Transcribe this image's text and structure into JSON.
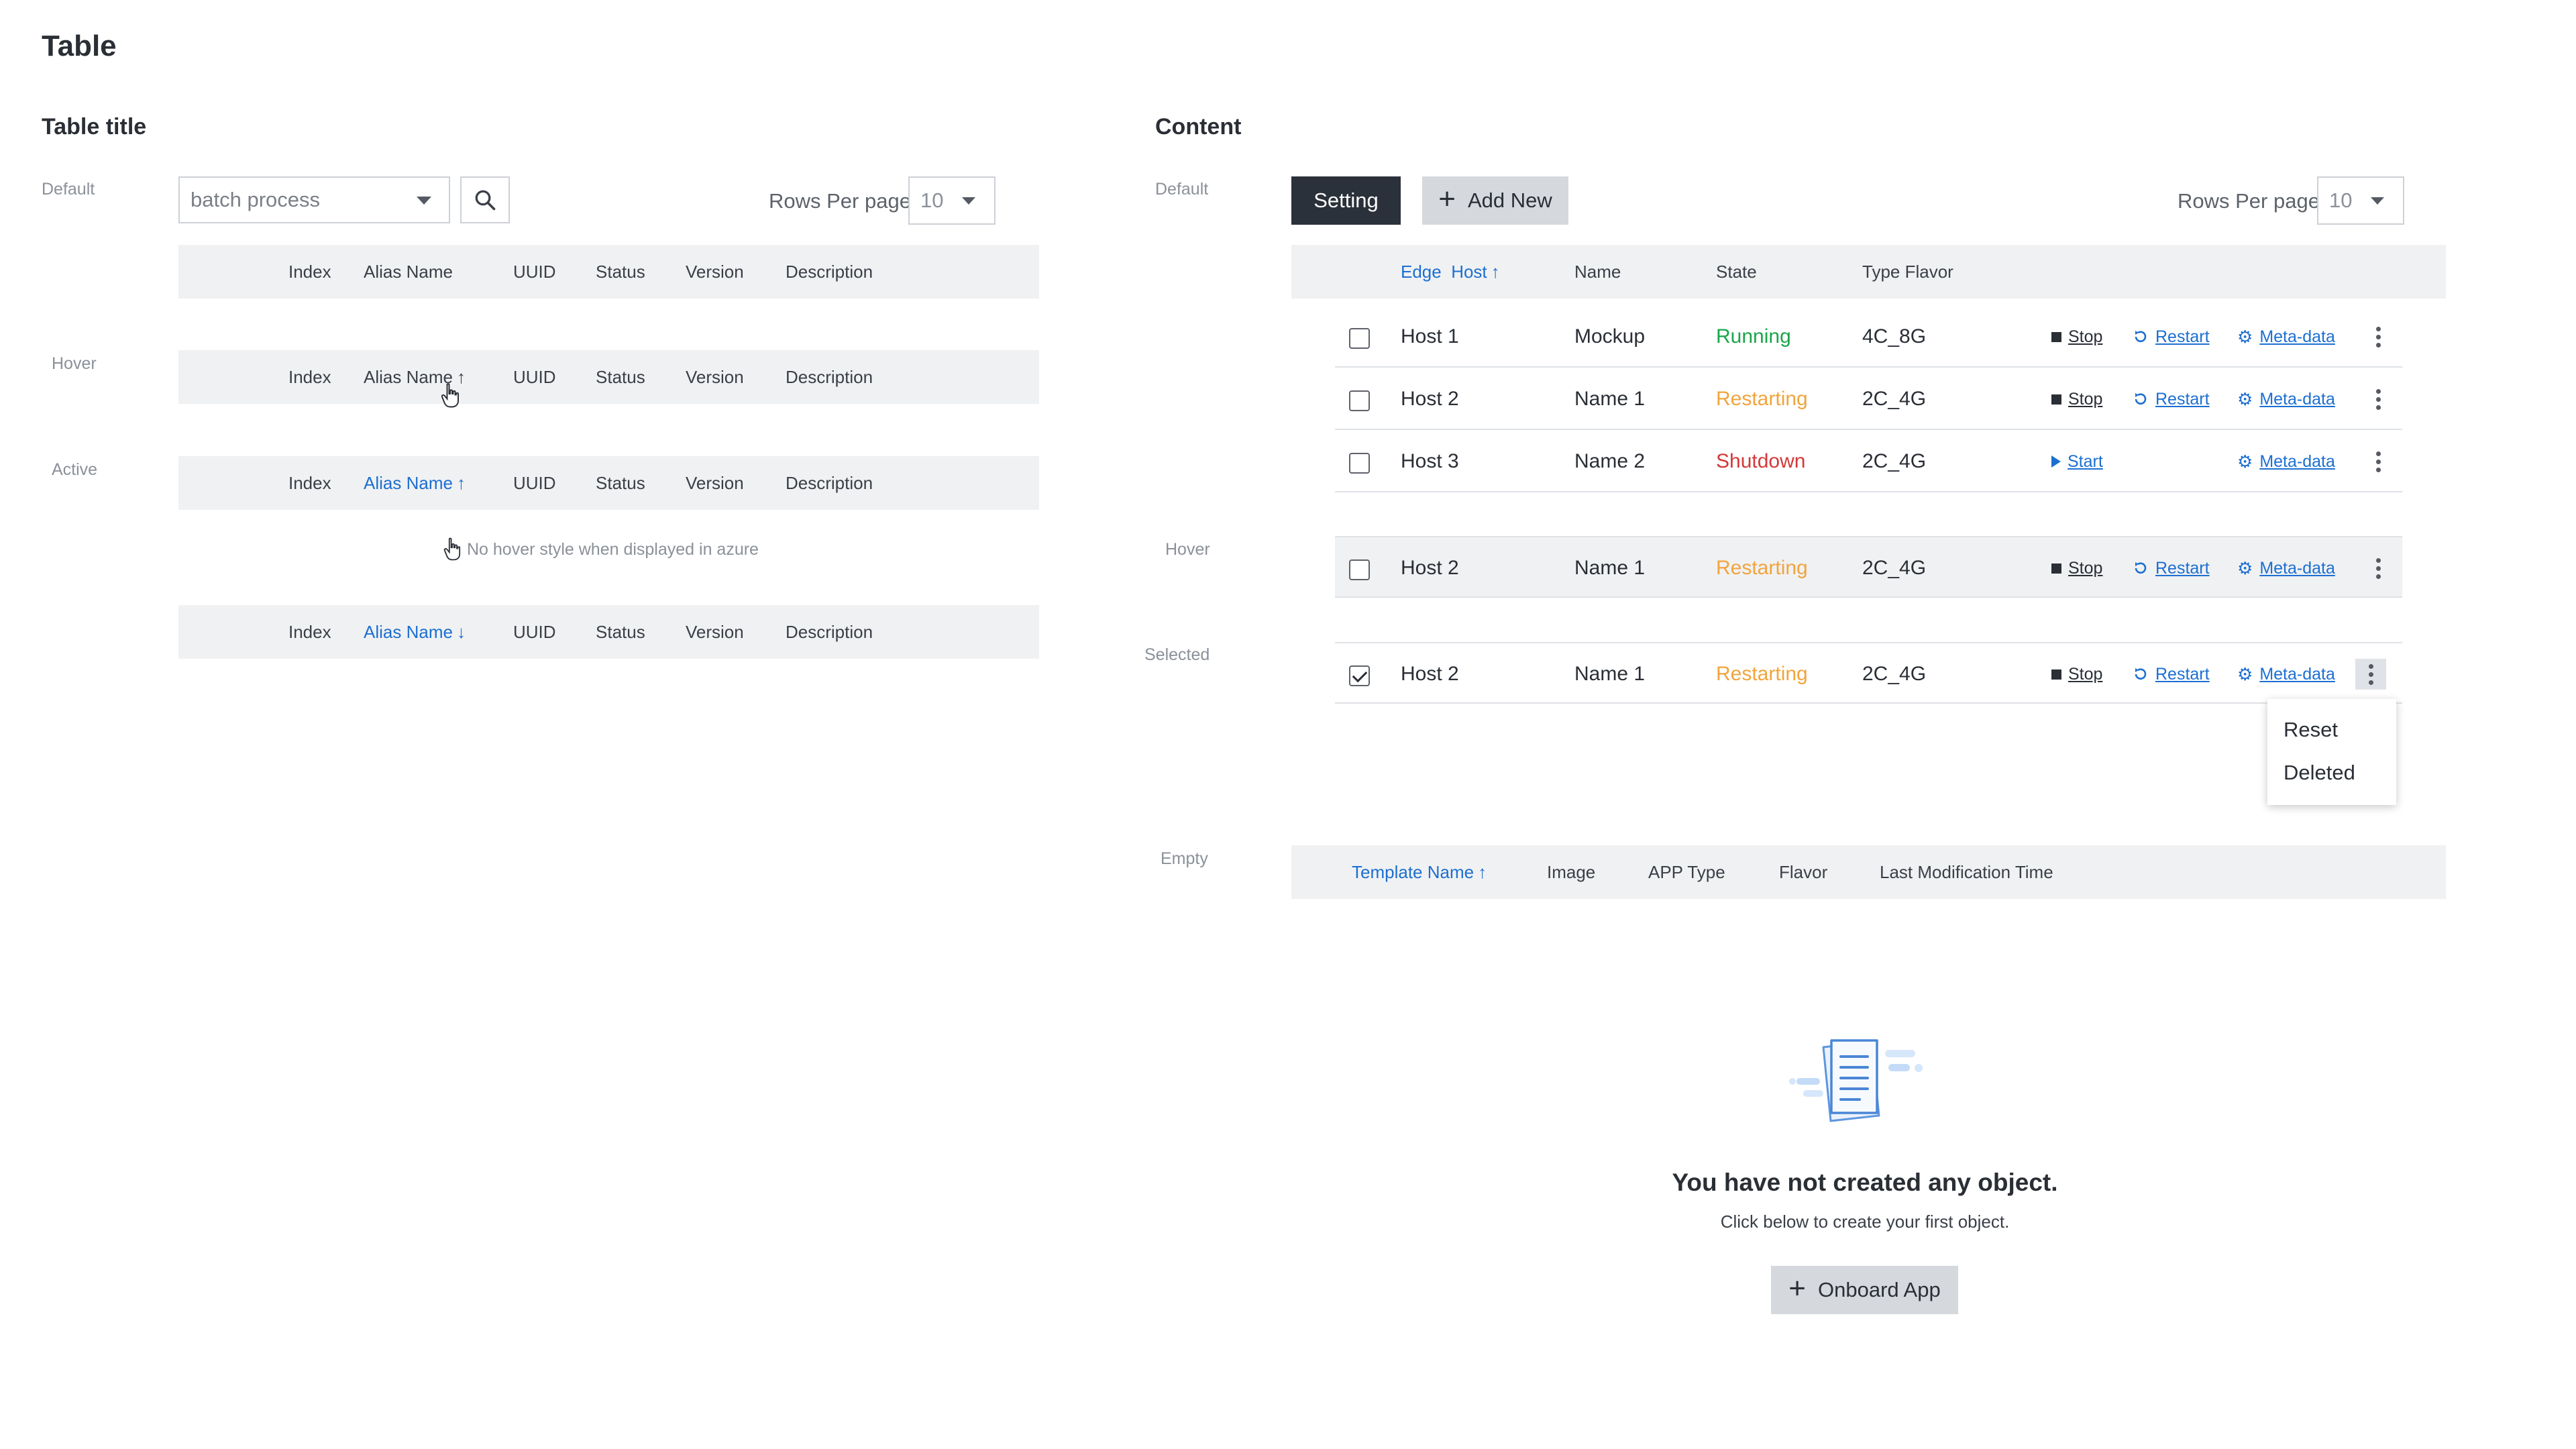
{
  "page": {
    "title": "Table"
  },
  "left": {
    "title": "Table title",
    "states": {
      "default": "Default",
      "hover": "Hover",
      "active": "Active"
    },
    "search": {
      "value": "batch process"
    },
    "rows_per_page": {
      "label": "Rows Per page",
      "value": "10"
    },
    "columns": [
      "Index",
      "Alias Name",
      "UUID",
      "Status",
      "Version",
      "Description"
    ],
    "sort_asc": "↑",
    "sort_desc": "↓",
    "note": "No hover style when displayed in azure"
  },
  "right": {
    "title": "Content",
    "states": {
      "default": "Default",
      "hover": "Hover",
      "selected": "Selected",
      "empty": "Empty"
    },
    "toolbar": {
      "setting_label": "Setting",
      "add_new_label": "Add New"
    },
    "rows_per_page": {
      "label": "Rows Per page",
      "value": "10"
    },
    "columns": {
      "edge": "Edge",
      "host": "Host",
      "sort": "↑",
      "name": "Name",
      "state": "State",
      "type_flavor": "Type Flavor"
    },
    "rows": [
      {
        "host": "Host 1",
        "name": "Mockup",
        "state": "Running",
        "flavor": "4C_8G",
        "primary_action": "Stop",
        "restart": "Restart",
        "meta": "Meta-data"
      },
      {
        "host": "Host 2",
        "name": "Name 1",
        "state": "Restarting",
        "flavor": "2C_4G",
        "primary_action": "Stop",
        "restart": "Restart",
        "meta": "Meta-data"
      },
      {
        "host": "Host 3",
        "name": "Name 2",
        "state": "Shutdown",
        "flavor": "2C_4G",
        "primary_action": "Start",
        "restart": "",
        "meta": "Meta-data"
      }
    ],
    "hover_row": {
      "host": "Host 2",
      "name": "Name 1",
      "state": "Restarting",
      "flavor": "2C_4G",
      "primary_action": "Stop",
      "restart": "Restart",
      "meta": "Meta-data"
    },
    "selected_row": {
      "host": "Host 2",
      "name": "Name 1",
      "state": "Restarting",
      "flavor": "2C_4G",
      "primary_action": "Stop",
      "restart": "Restart",
      "meta": "Meta-data"
    },
    "menu": {
      "items": [
        "Reset",
        "Deleted"
      ]
    },
    "empty_table": {
      "columns": [
        "Template Name",
        "Image",
        "APP Type",
        "Flavor",
        "Last Modification Time"
      ],
      "sort": "↑",
      "title": "You have not created any object.",
      "subtitle": "Click below to create your first object.",
      "button_label": "Onboard App"
    }
  },
  "colors": {
    "accent": "#1c6fd1",
    "running": "#1aa64a",
    "restarting": "#f2a43c",
    "shutdown": "#d33939",
    "dark_button": "#2b313a"
  }
}
